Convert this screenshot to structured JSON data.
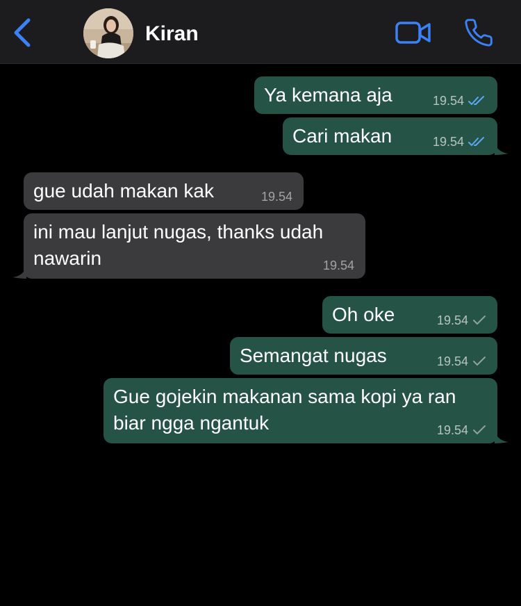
{
  "header": {
    "contact_name": "Kiran",
    "back_icon": "chevron-left-icon",
    "video_icon": "video-camera-icon",
    "call_icon": "phone-icon"
  },
  "colors": {
    "accent": "#3b82f6",
    "outgoing_bubble": "#255447",
    "incoming_bubble": "#3b3b3d",
    "read_tick": "#5aa9f5",
    "sent_tick": "#8fa39b"
  },
  "messages": [
    {
      "direction": "out",
      "text": "Ya kemana aja",
      "time": "19.54",
      "status": "read"
    },
    {
      "direction": "out",
      "text": "Cari makan",
      "time": "19.54",
      "status": "read"
    },
    {
      "direction": "in",
      "text": "gue udah makan kak",
      "time": "19.54"
    },
    {
      "direction": "in",
      "text": "ini mau lanjut nugas, thanks udah nawarin",
      "time": "19.54"
    },
    {
      "direction": "out",
      "text": "Oh oke",
      "time": "19.54",
      "status": "sent"
    },
    {
      "direction": "out",
      "text": "Semangat nugas",
      "time": "19.54",
      "status": "sent"
    },
    {
      "direction": "out",
      "text": "Gue gojekin makanan sama kopi ya ran biar ngga ngantuk",
      "time": "19.54",
      "status": "sent"
    }
  ]
}
